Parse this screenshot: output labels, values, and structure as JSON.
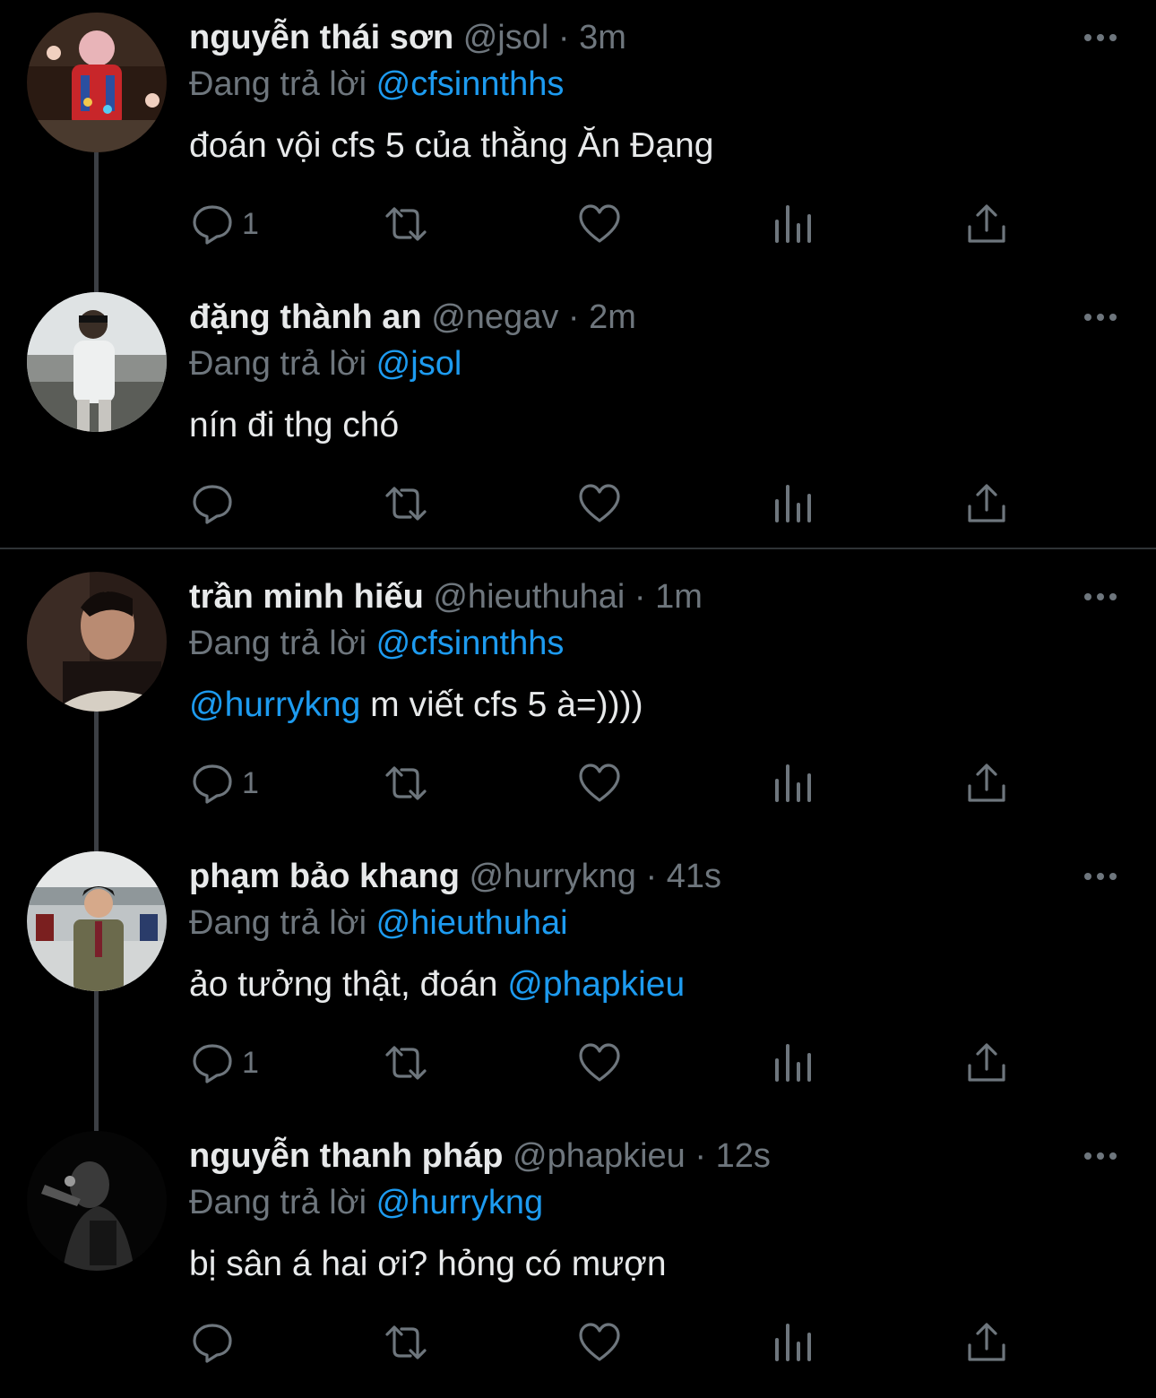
{
  "reply_label": "Đang trả lời",
  "tweets": [
    {
      "name": "nguyễn thái sơn",
      "handle": "@jsol",
      "dot": "·",
      "time": "3m",
      "reply_to": "@cfsinnthhs",
      "text_mention": "",
      "text": "đoán vội cfs 5 của thằng Ăn Đạng",
      "text_mention_after": "",
      "reply_count": "1"
    },
    {
      "name": "đặng thành an",
      "handle": "@negav",
      "dot": "·",
      "time": "2m",
      "reply_to": "@jsol",
      "text_mention": "",
      "text": "nín đi thg chó",
      "text_mention_after": "",
      "reply_count": ""
    },
    {
      "name": "trần minh hiếu",
      "handle": "@hieuthuhai",
      "dot": "·",
      "time": "1m",
      "reply_to": "@cfsinnthhs",
      "text_mention": "@hurrykng",
      "text": " m viết cfs 5 à=))))",
      "text_mention_after": "",
      "reply_count": "1"
    },
    {
      "name": "phạm bảo khang",
      "handle": "@hurrykng",
      "dot": "·",
      "time": "41s",
      "reply_to": "@hieuthuhai",
      "text_mention": "",
      "text": "ảo tưởng thật, đoán ",
      "text_mention_after": "@phapkieu",
      "reply_count": "1"
    },
    {
      "name": "nguyễn thanh pháp",
      "handle": "@phapkieu",
      "dot": "·",
      "time": "12s",
      "reply_to": "@hurrykng",
      "text_mention": "",
      "text": "bị sân á hai ơi? hỏng có mượn",
      "text_mention_after": "",
      "reply_count": ""
    }
  ],
  "icons": {
    "reply": "reply-icon",
    "retweet": "retweet-icon",
    "like": "heart-icon",
    "analytics": "analytics-icon",
    "share": "share-icon",
    "more": "more-icon"
  },
  "colors": {
    "background": "#000000",
    "text": "#e7e9ea",
    "muted": "#6e767d",
    "accent": "#1d9bf0"
  }
}
